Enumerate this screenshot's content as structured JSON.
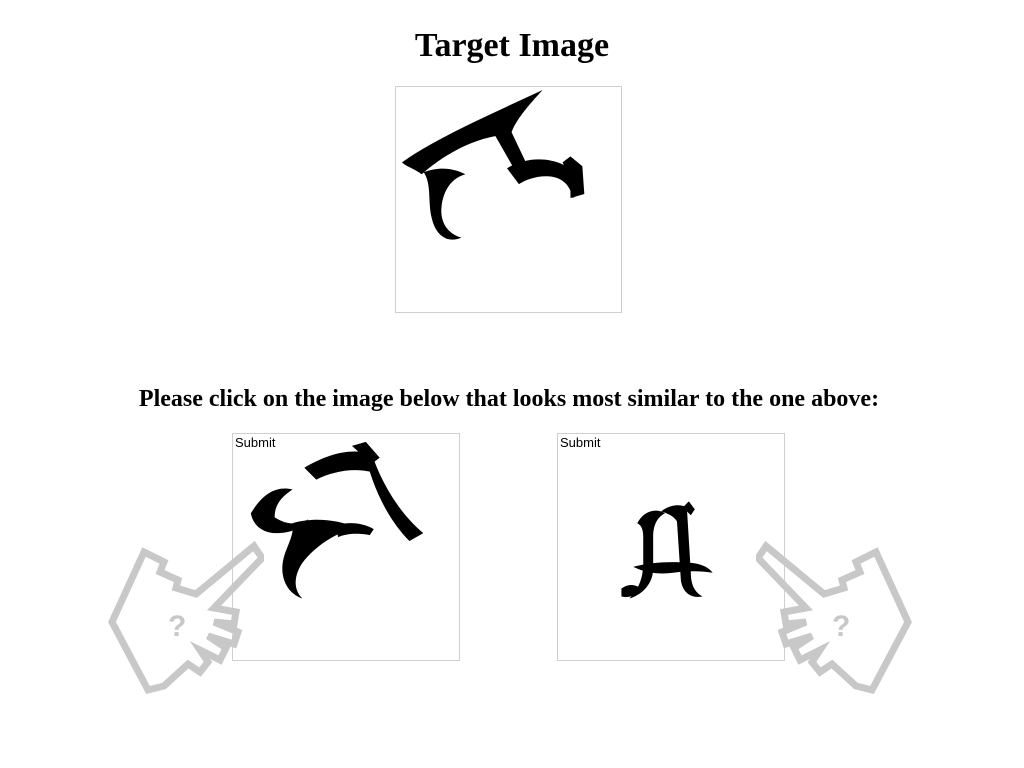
{
  "header": {
    "title": "Target Image"
  },
  "target": {
    "icon": "gothic-letter-glyph-rotated"
  },
  "instruction": "Please click on the image below that looks most similar to the one above:",
  "options": [
    {
      "label": "Submit",
      "icon": "gothic-letter-glyph-rotated"
    },
    {
      "label": "Submit",
      "icon": "gothic-letter-a-glyph"
    }
  ],
  "hint": {
    "left_symbol": "?",
    "right_symbol": "?",
    "color": "#c8c8c8"
  },
  "colors": {
    "border": "#cfcfcf",
    "background": "#ffffff",
    "text": "#000000"
  }
}
